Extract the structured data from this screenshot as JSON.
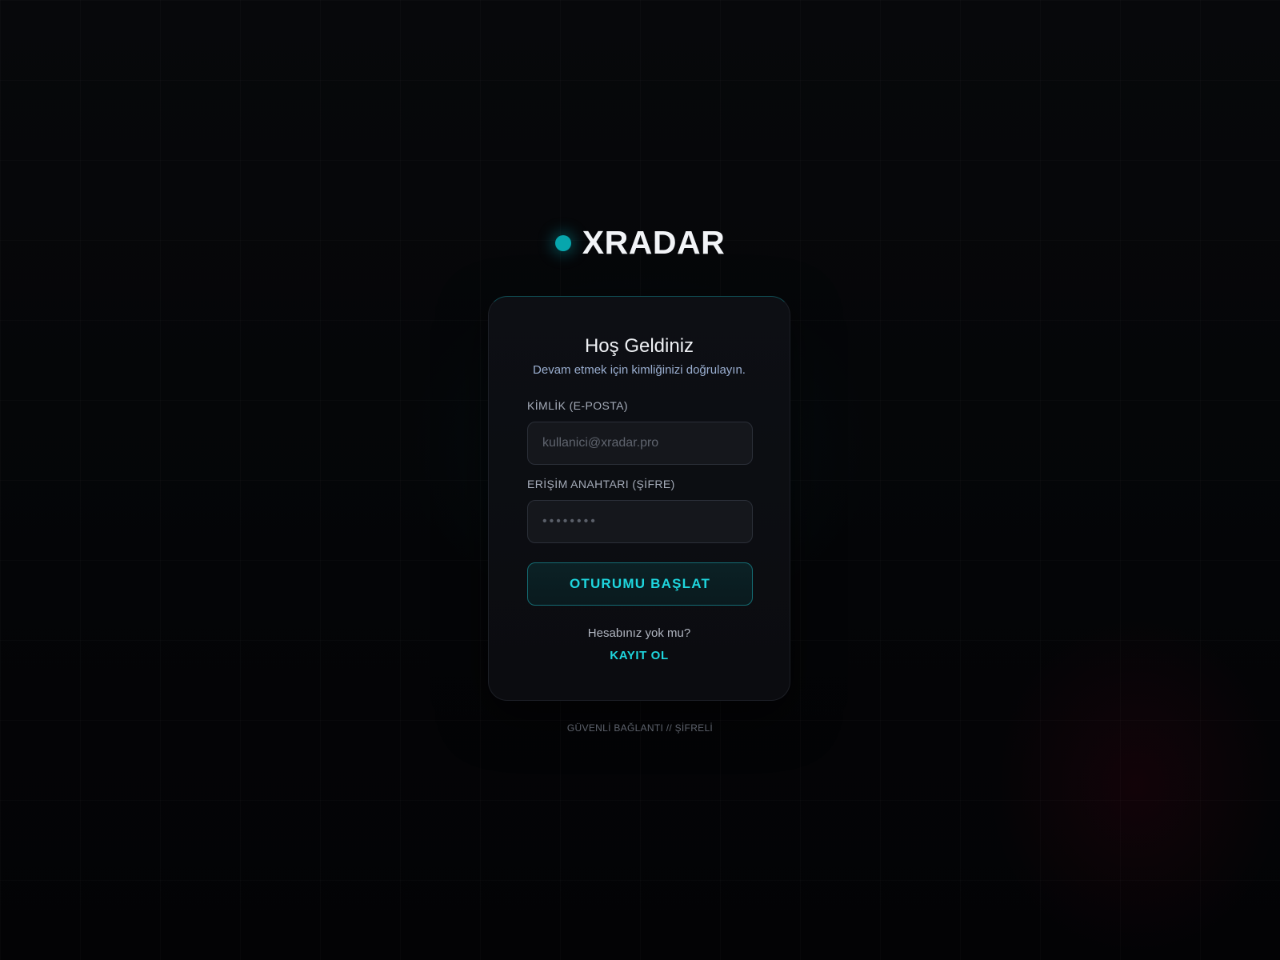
{
  "brand": {
    "name": "XRADAR",
    "dot_color": "#07a6ad"
  },
  "login_card": {
    "title": "Hoş Geldiniz",
    "subtitle": "Devam etmek için kimliğinizi doğrulayın.",
    "email": {
      "label": "KİMLİK (E-POSTA)",
      "placeholder": "kullanici@xradar.pro",
      "value": ""
    },
    "password": {
      "label": "ERİŞİM ANAHTARI (ŞİFRE)",
      "placeholder": "••••••••",
      "value": ""
    },
    "submit_label": "OTURUMU BAŞLAT",
    "no_account_text": "Hesabınız yok mu?",
    "register_label": "KAYIT OL"
  },
  "footer": {
    "text": "GÜVENLİ BAĞLANTI // ŞİFRELİ"
  },
  "colors": {
    "accent": "#1ed6de",
    "background": "#040507",
    "card": "#0c0e12"
  }
}
